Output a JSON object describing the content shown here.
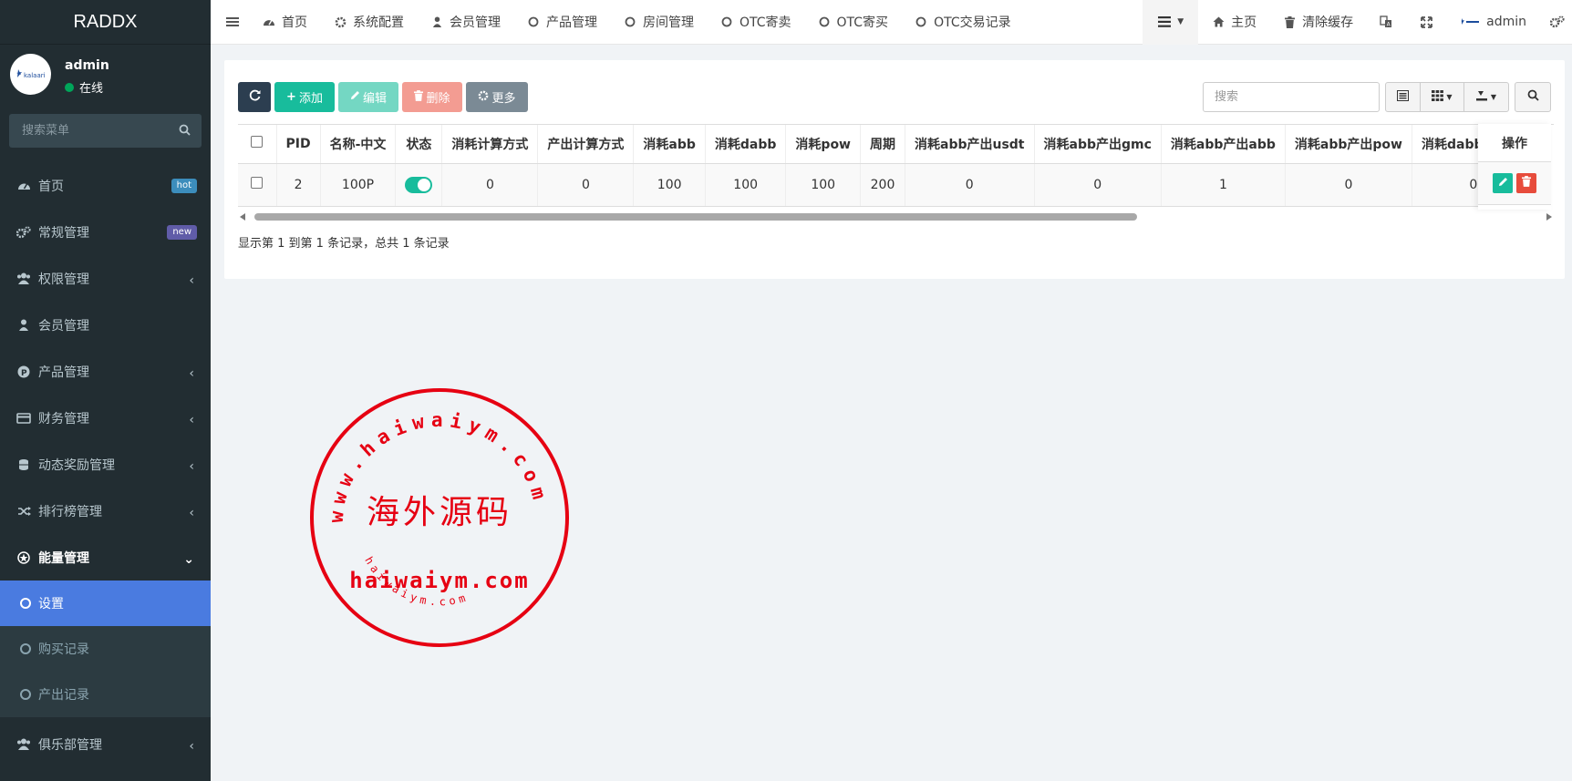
{
  "brand": "RADDX",
  "user": {
    "name": "admin",
    "status": "在线",
    "avatar_text": "kalaari"
  },
  "sidebar": {
    "search_placeholder": "搜索菜单",
    "items": [
      {
        "label": "首页",
        "icon": "dashboard-icon",
        "badge": "hot",
        "badge_color": "#3c8dbc"
      },
      {
        "label": "常规管理",
        "icon": "cogs-icon",
        "badge": "new",
        "badge_color": "#605ca8"
      },
      {
        "label": "权限管理",
        "icon": "users-icon"
      },
      {
        "label": "会员管理",
        "icon": "user-icon"
      },
      {
        "label": "产品管理",
        "icon": "product-p-icon"
      },
      {
        "label": "财务管理",
        "icon": "credit-card-icon"
      },
      {
        "label": "动态奖励管理",
        "icon": "reward-icon"
      },
      {
        "label": "排行榜管理",
        "icon": "random-icon"
      },
      {
        "label": "能量管理",
        "icon": "energy-icon"
      }
    ],
    "sub_items": [
      {
        "label": "设置"
      },
      {
        "label": "购买记录"
      },
      {
        "label": "产出记录"
      }
    ],
    "last_item": {
      "label": "俱乐部管理",
      "icon": "users-icon"
    }
  },
  "topnav": {
    "tabs": [
      "首页",
      "系统配置",
      "会员管理",
      "产品管理",
      "房间管理",
      "OTC寄卖",
      "OTC寄买",
      "OTC交易记录"
    ],
    "home": "主页",
    "clear_cache": "清除缓存",
    "admin": "admin"
  },
  "toolbar": {
    "add": "添加",
    "edit": "编辑",
    "delete": "删除",
    "more": "更多",
    "search_placeholder": "搜索"
  },
  "table": {
    "headers": [
      "PID",
      "名称-中文",
      "状态",
      "消耗计算方式",
      "产出计算方式",
      "消耗abb",
      "消耗dabb",
      "消耗pow",
      "周期",
      "消耗abb产出usdt",
      "消耗abb产出gmc",
      "消耗abb产出abb",
      "消耗abb产出pow",
      "消耗dabb产出us"
    ],
    "rows": [
      {
        "pid": "2",
        "name": "100P",
        "status_on": true,
        "consume_calc": "0",
        "output_calc": "0",
        "consume_abb": "100",
        "consume_dabb": "100",
        "consume_pow": "100",
        "period": "200",
        "abb_usdt": "0",
        "abb_gmc": "0",
        "abb_abb": "1",
        "abb_pow": "0",
        "dabb_us": "0"
      }
    ],
    "op_header": "操作"
  },
  "pagination": {
    "info": "显示第 1 到第 1 条记录，总共 1 条记录"
  },
  "watermark": {
    "top": "www.haiwaiym.com",
    "center": "海外源码",
    "domain": "haiwaiym.com",
    "bottom": "haiwaiym.com",
    "color": "#e60012"
  }
}
